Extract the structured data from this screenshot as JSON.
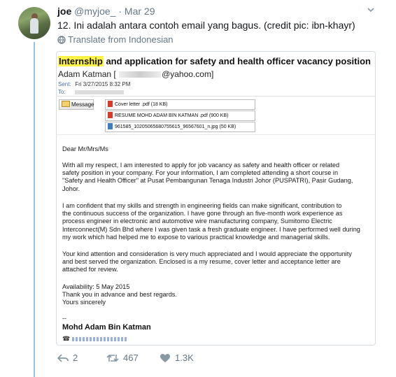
{
  "tweet": {
    "name": "joe",
    "handle": "@myjoe_",
    "separator": "·",
    "date": "Mar 29",
    "text": "12. Ini adalah antara contoh email yang bagus. (credit pic: ibn-khayr)",
    "translate_label": "Translate from Indonesian",
    "icons": {
      "caret": "chevron-down-icon",
      "translate": "globe-icon"
    }
  },
  "email": {
    "subject_highlight": "Internship",
    "subject_rest": " and application for safety and health officer vacancy position",
    "from_name": "Adam Katman [",
    "from_domain": "@yahoo.com]",
    "sent_key": "Sent:",
    "sent_value": "Fri 3/27/2015 8:32 PM",
    "to_key": "To:",
    "message_button": "Message",
    "attachments": [
      "Cover letter .pdf (18 KB)",
      "RESUME MOHD ADAM BIN KATMAN .pdf (900 KB)",
      "961585_10205065680755615_96567601_n.jpg (50 KB)"
    ],
    "greeting": "Dear Mr/Mrs/Ms",
    "p1": [
      "With all my respect, I am interested to apply for  job vacancy as safety and health officer or related",
      "safety position in your company. For your information, I am completed attending a short course in",
      "\"Safety and Health Officer\" at Pusat Pembangunan Tenaga Industri Johor (PUSPATRI), Pasir Gudang,",
      "Johor."
    ],
    "p2": [
      "I am confident that my skills and strength in engineering fields can make significant, contribution to",
      "the continuous success of the organization. I have gone through an five-month work experience as",
      "process engineer in electronic and automotive wire manufacturing company, Sumitomo Electric",
      "Interconnect(M) Sdn Bhd where I was given task a fresh graduate engineer. I have performed well during",
      "my work which had helped me to expose to various practical knowledge and managerial skills."
    ],
    "p3": [
      "Your kind attention and consideration is very much appreciated and I would appreciate the opportunity",
      "and best served the organization. Enclosed is a my resume, cover letter and acceptance letter are",
      "attached for review."
    ],
    "closing": [
      "Availability: 5 May 2015",
      "Thank you in advance and best regards.",
      "Yours sincerely"
    ],
    "dash": "--",
    "signature": "Mohd Adam Bin Katman",
    "phone_symbol": "☎"
  },
  "actions": {
    "replies": "2",
    "retweets": "467",
    "likes": "1.3K",
    "icons": {
      "reply": "reply-icon",
      "retweet": "retweet-icon",
      "like": "heart-icon"
    },
    "colors": {
      "icon": "#657786",
      "thread": "#8ec3e8"
    }
  }
}
